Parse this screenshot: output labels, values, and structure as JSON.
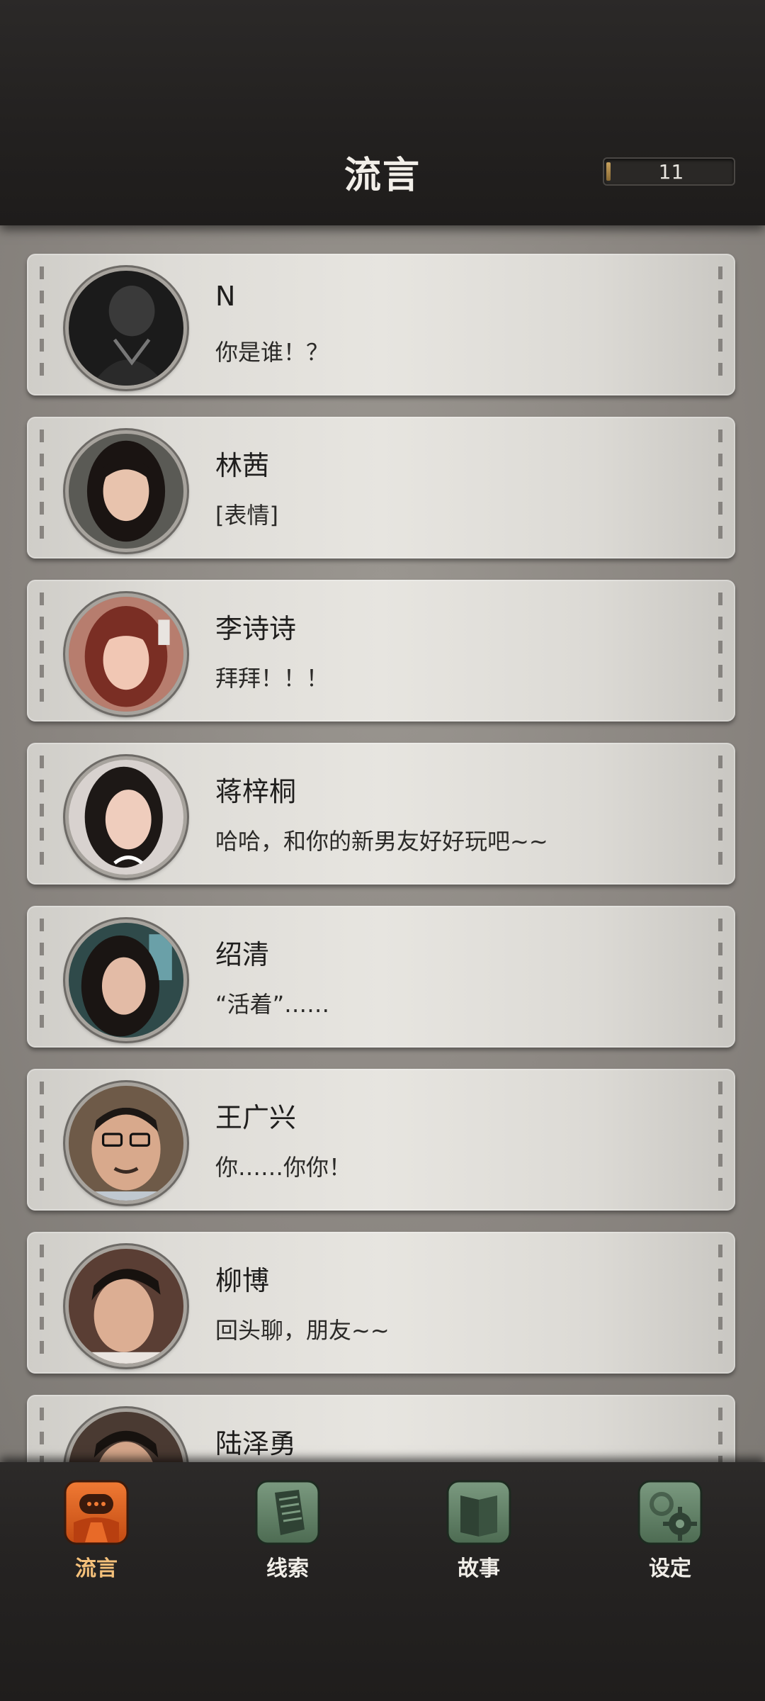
{
  "header": {
    "title": "流言",
    "counter_value": "11"
  },
  "messages": [
    {
      "name": "N",
      "preview": "你是谁！？"
    },
    {
      "name": "林茜",
      "preview": "[表情]"
    },
    {
      "name": "李诗诗",
      "preview": "拜拜！！！"
    },
    {
      "name": "蒋梓桐",
      "preview": "哈哈，和你的新男友好好玩吧~~"
    },
    {
      "name": "绍清",
      "preview": "“活着”……"
    },
    {
      "name": "王广兴",
      "preview": "你……你你！"
    },
    {
      "name": "柳博",
      "preview": "回头聊，朋友~~"
    },
    {
      "name": "陆泽勇",
      "preview": ""
    }
  ],
  "nav": {
    "items": [
      {
        "label": "流言",
        "icon": "chat-bubble-icon",
        "active": true
      },
      {
        "label": "线索",
        "icon": "paper-note-icon",
        "active": false
      },
      {
        "label": "故事",
        "icon": "book-icon",
        "active": false
      },
      {
        "label": "设定",
        "icon": "gear-icon",
        "active": false
      }
    ]
  },
  "colors": {
    "active_tab": "#e2621e",
    "inactive_tab": "#5d7a62",
    "active_label": "#f4c07a"
  }
}
